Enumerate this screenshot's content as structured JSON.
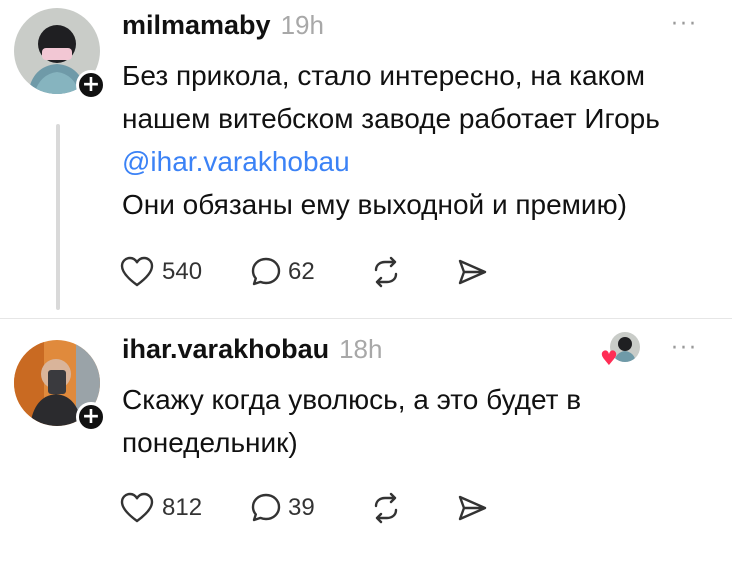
{
  "posts": [
    {
      "username": "milmamaby",
      "time": "19h",
      "text_before_mention": "Без прикола, стало интересно, на каком нашем витебском заводе работает Игорь ",
      "mention": "@ihar.varakhobau",
      "text_after_mention": "Они обязаны ему выходной и премию)",
      "likes": "540",
      "replies": "62",
      "follow_badge": "+",
      "more": "···"
    },
    {
      "username": "ihar.varakhobau",
      "time": "18h",
      "text": "Скажу когда уволюсь, а это будет в понедельник)",
      "likes": "812",
      "replies": "39",
      "follow_badge": "+",
      "more": "···"
    }
  ],
  "icons": {
    "like": "heart-outline-icon",
    "reply": "speech-bubble-icon",
    "repost": "repost-arrows-icon",
    "share": "paper-plane-icon",
    "liked_by_author": "heart-filled-icon"
  },
  "colors": {
    "mention": "#3b82f6",
    "time": "#a8a8a8",
    "liked_heart": "#ff2d55"
  }
}
